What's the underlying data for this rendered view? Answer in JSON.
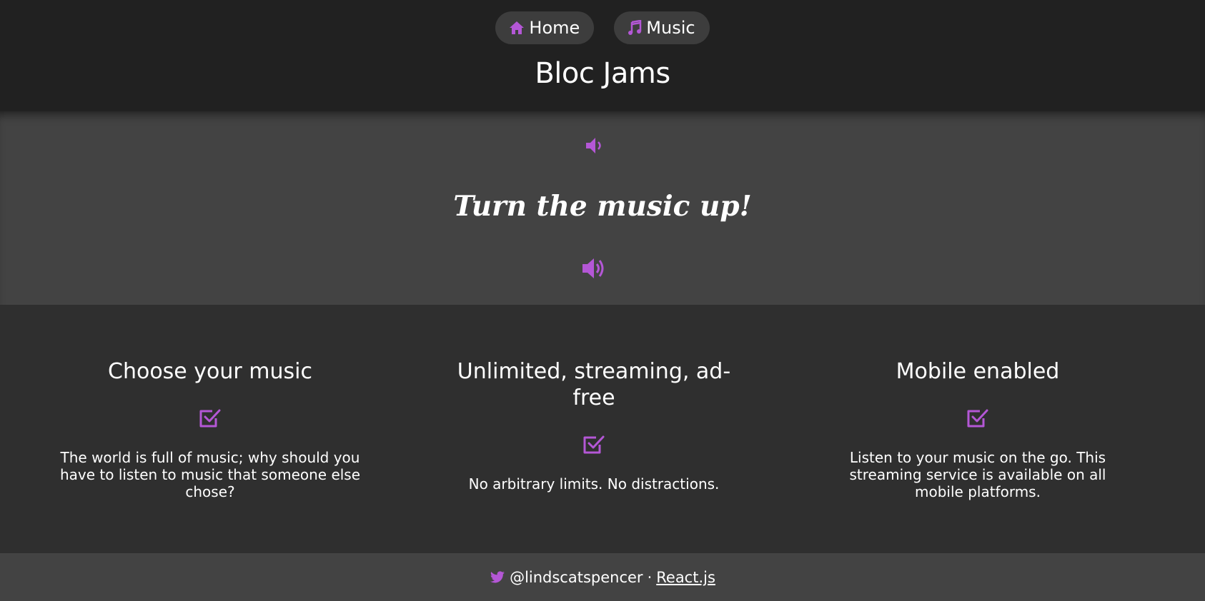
{
  "colors": {
    "accent": "#b457d6",
    "header_bg": "#212121",
    "hero_bg": "#434343",
    "features_bg": "#2f2f2f",
    "footer_bg": "#434343",
    "text": "#ffffff"
  },
  "nav": {
    "items": [
      {
        "label": "Home",
        "icon": "home-icon"
      },
      {
        "label": "Music",
        "icon": "music-note-icon"
      }
    ]
  },
  "header": {
    "title": "Bloc Jams"
  },
  "hero": {
    "title": "Turn the music up!",
    "icons": [
      "volume-low-icon",
      "volume-high-icon"
    ]
  },
  "features": [
    {
      "title": "Choose your music",
      "icon": "checkbox-icon",
      "description": "The world is full of music; why should you have to listen to music that someone else chose?"
    },
    {
      "title": "Unlimited, streaming, ad-free",
      "icon": "checkbox-icon",
      "description": "No arbitrary limits. No distractions."
    },
    {
      "title": "Mobile enabled",
      "icon": "checkbox-icon",
      "description": "Listen to your music on the go. This streaming service is available on all mobile platforms."
    }
  ],
  "footer": {
    "icon": "twitter-icon",
    "handle": "@lindscatspencer",
    "separator": "·",
    "link_label": "React.js"
  }
}
